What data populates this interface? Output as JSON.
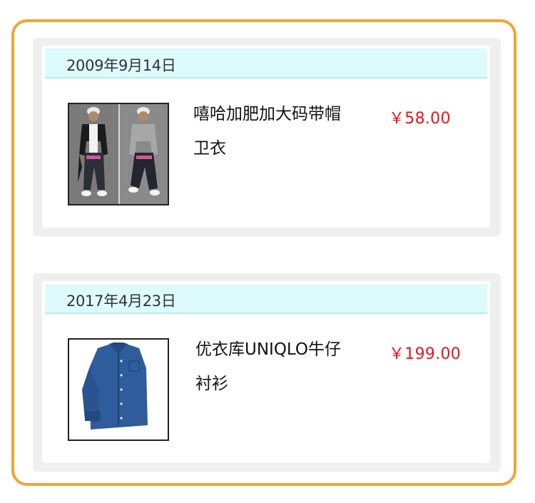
{
  "colors": {
    "frame_border": "#f0a535",
    "card_bg": "#efefef",
    "date_bar_bg": "#ddfbfd",
    "price": "#e8141c"
  },
  "orders": [
    {
      "date": "2009年9月14日",
      "title_line1": "嘻哈加肥加大码带帽",
      "title_line2": "卫衣",
      "price": "￥58.00",
      "image_icon": "hoodie-product-photo"
    },
    {
      "date": "2017年4月23日",
      "title_line1": "优衣库UNIQLO牛仔",
      "title_line2": "衬衫",
      "price": "￥199.00",
      "image_icon": "denim-shirt-product-photo"
    }
  ]
}
